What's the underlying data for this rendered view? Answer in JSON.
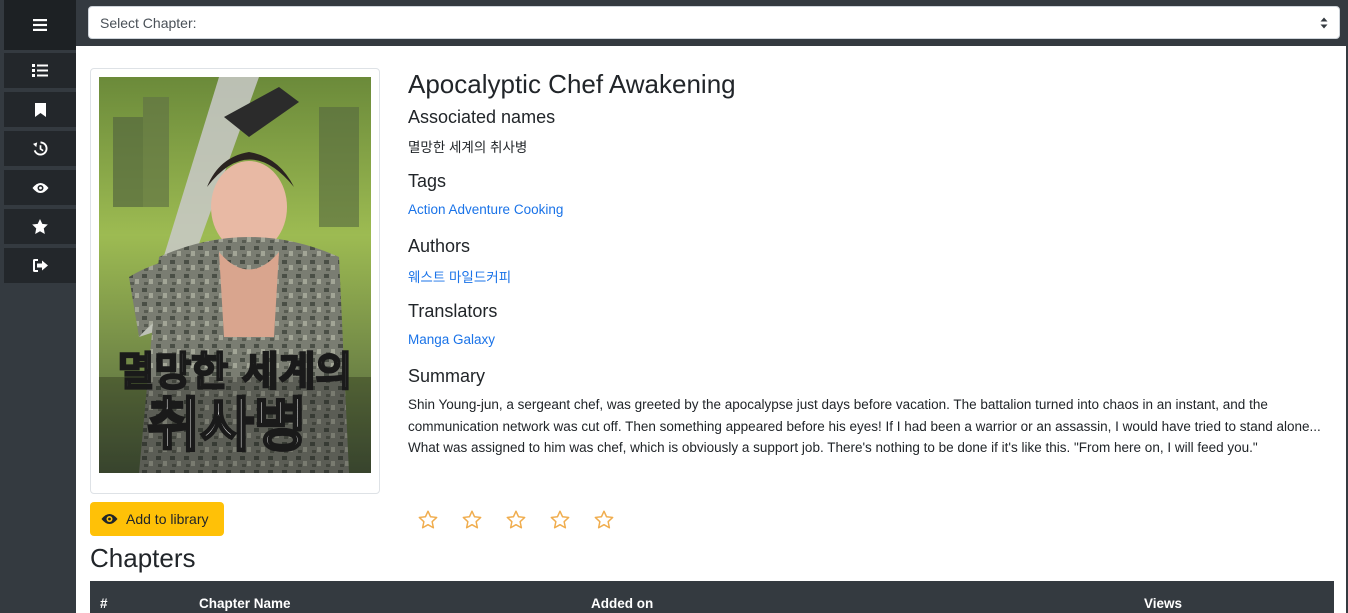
{
  "sidebar": {
    "items": [
      {
        "icon": "menu-icon"
      },
      {
        "icon": "list-icon"
      },
      {
        "icon": "bookmark-icon"
      },
      {
        "icon": "history-icon"
      },
      {
        "icon": "eye-icon"
      },
      {
        "icon": "star-icon"
      },
      {
        "icon": "sign-out-icon"
      }
    ]
  },
  "chapter_select": {
    "selected": "Select Chapter:"
  },
  "manga": {
    "title": "Apocalyptic Chef Awakening",
    "associated_names_heading": "Associated names",
    "associated_names": "멸망한 세계의 취사병",
    "tags_heading": "Tags",
    "tags": "Action Adventure Cooking",
    "authors_heading": "Authors",
    "authors": "웨스트 마일드커피",
    "translators_heading": "Translators",
    "translators": "Manga Galaxy",
    "summary_heading": "Summary",
    "summary": "Shin Young-jun, a sergeant chef, was greeted by the apocalypse just days before vacation. The battalion turned into chaos in an instant, and the communication network was cut off. Then something appeared before his eyes! If I had been a warrior or an assassin, I would have tried to stand alone... What was assigned to him was chef, which is obviously a support job. There's nothing to be done if it's like this. \"From here on, I will feed you.\"",
    "cover_title_text": "멸망한 세계의 취사병"
  },
  "actions": {
    "add_to_library": "Add to library"
  },
  "rating": {
    "stars": 5,
    "filled": 0
  },
  "chapters": {
    "heading": "Chapters",
    "columns": [
      "#",
      "Chapter Name",
      "Added on",
      "Views"
    ]
  },
  "colors": {
    "sidebar_bg": "#343a40",
    "accent": "#ffc107",
    "link": "#1a73e8",
    "star": "#f0ad4e"
  }
}
